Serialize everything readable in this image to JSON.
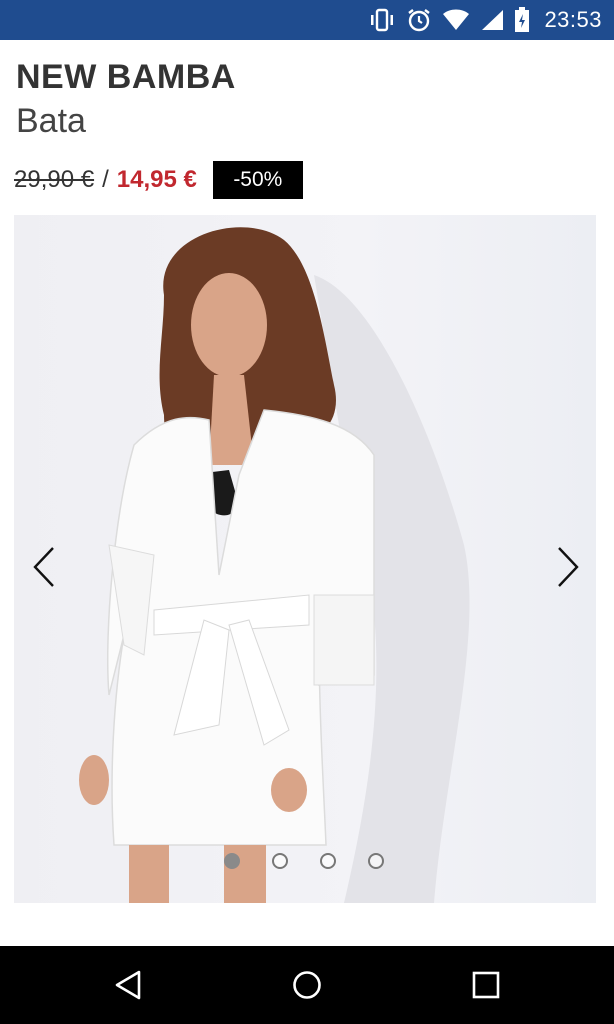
{
  "status_bar": {
    "time": "23:53",
    "icons": [
      "vibrate-icon",
      "alarm-icon",
      "wifi-icon",
      "signal-icon",
      "battery-charging-icon"
    ],
    "background": "#1f4c8f"
  },
  "product": {
    "brand": "NEW BAMBA",
    "subtitle": "Bata",
    "old_price": "29,90 €",
    "separator": "/",
    "new_price": "14,95 €",
    "discount": "-50%",
    "sale_color": "#c1282f"
  },
  "carousel": {
    "image_description_icon": "product-photo",
    "prev_icon": "chevron-left-icon",
    "next_icon": "chevron-right-icon",
    "slide_count": 4,
    "active_slide": 1
  },
  "nav_bar": {
    "icons": [
      "back-icon",
      "home-icon",
      "recents-icon"
    ]
  }
}
